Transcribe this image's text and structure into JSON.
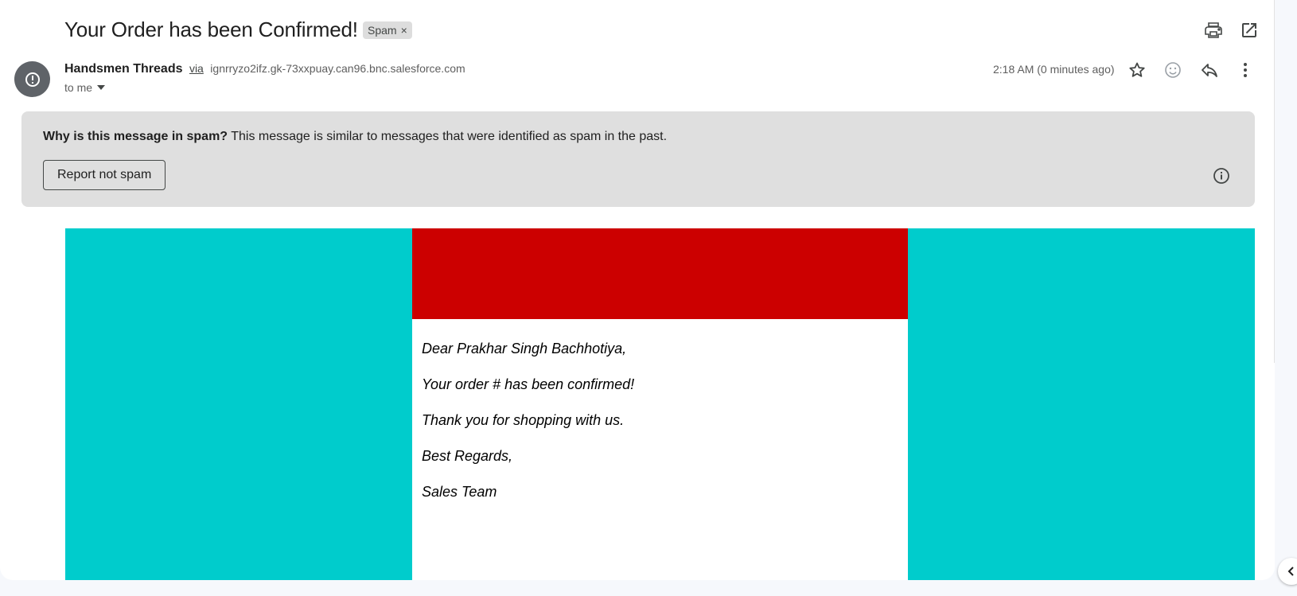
{
  "email": {
    "subject": "Your Order has been Confirmed!",
    "label": "Spam",
    "label_remove": "×",
    "sender_name": "Handsmen Threads",
    "via": "via",
    "sender_address": "ignrryzo2ifz.gk-73xxpuay.can96.bnc.salesforce.com",
    "recipient": "to me",
    "timestamp": "2:18 AM (0 minutes ago)"
  },
  "spam_notice": {
    "question": "Why is this message in spam?",
    "explanation": "This message is similar to messages that were identified as spam in the past.",
    "report_button": "Report not spam"
  },
  "body": {
    "greeting": "Dear Prakhar Singh Bachhotiya,",
    "line1": "Your order # has been confirmed!",
    "line2": "Thank you for shopping with us.",
    "closing": "Best Regards,",
    "signature": "Sales Team"
  },
  "icons": {
    "print": "print-icon",
    "open_new_window": "open-in-new-window-icon",
    "sender_avatar": "spam-warning-icon",
    "star": "star-icon",
    "emoji": "emoji-reaction-icon",
    "reply": "reply-icon",
    "more": "more-vertical-icon",
    "info": "info-icon",
    "side_panel": "chevron-left-icon"
  },
  "colors": {
    "teal": "#00cccc",
    "red_banner": "#cc0000",
    "spam_box": "#dfdfdf",
    "avatar": "#5f6368"
  }
}
